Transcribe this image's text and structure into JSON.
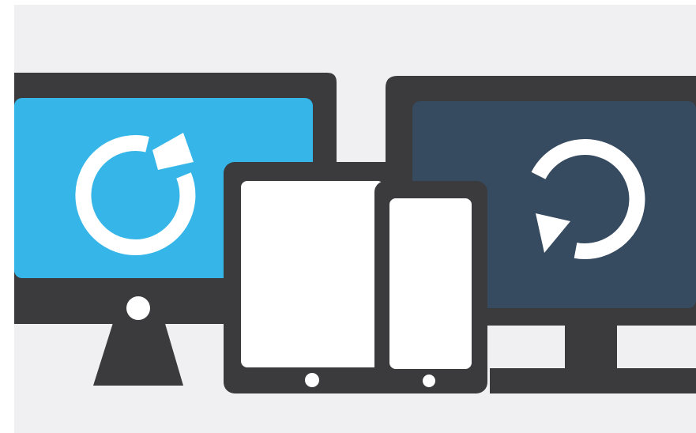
{
  "colors": {
    "page_bg": "#ffffff",
    "panel_bg": "#f0f0f2",
    "device_frame": "#3b3b3d",
    "screen_left": "#36b6e8",
    "screen_right": "#364a60",
    "device_screen_white": "#ffffff",
    "icon_stroke": "#ffffff"
  },
  "devices": {
    "left_monitor": {
      "kind": "desktop-monitor",
      "icon": "refresh-clockwise-icon"
    },
    "right_monitor": {
      "kind": "widescreen-monitor",
      "icon": "refresh-counterclockwise-icon"
    },
    "tablet": {
      "kind": "tablet"
    },
    "phone": {
      "kind": "smartphone"
    }
  }
}
